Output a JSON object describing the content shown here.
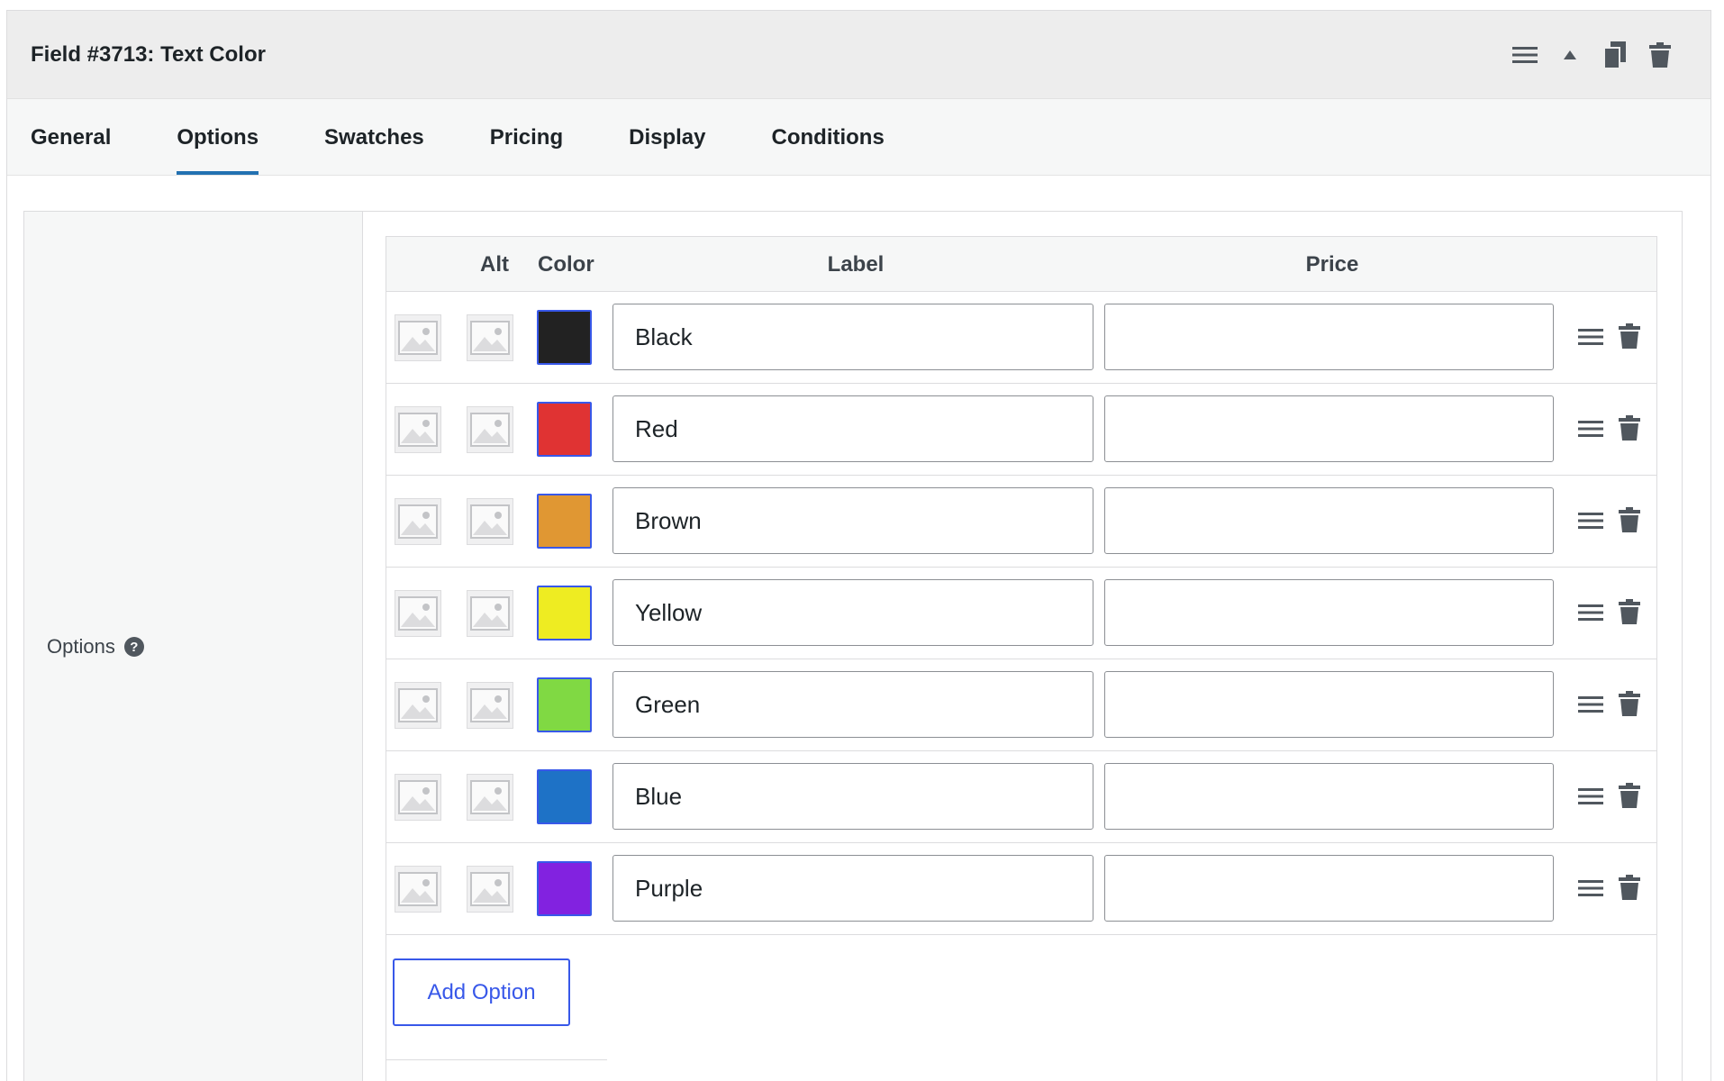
{
  "header": {
    "title": "Field #3713: Text Color",
    "icons": [
      "drag-handle-icon",
      "collapse-arrow-icon",
      "duplicate-icon",
      "trash-icon"
    ]
  },
  "tabs": [
    {
      "label": "General",
      "active": false
    },
    {
      "label": "Options",
      "active": true
    },
    {
      "label": "Swatches",
      "active": false
    },
    {
      "label": "Pricing",
      "active": false
    },
    {
      "label": "Display",
      "active": false
    },
    {
      "label": "Conditions",
      "active": false
    }
  ],
  "section": {
    "label": "Options",
    "help_icon": "?"
  },
  "table": {
    "columns": {
      "alt": "Alt",
      "color": "Color",
      "label": "Label",
      "price": "Price"
    },
    "rows": [
      {
        "label": "Black",
        "color": "#222222",
        "price": ""
      },
      {
        "label": "Red",
        "color": "#e03333",
        "price": ""
      },
      {
        "label": "Brown",
        "color": "#e09733",
        "price": ""
      },
      {
        "label": "Yellow",
        "color": "#eeec22",
        "price": ""
      },
      {
        "label": "Green",
        "color": "#80d943",
        "price": ""
      },
      {
        "label": "Blue",
        "color": "#1e72c6",
        "price": ""
      },
      {
        "label": "Purple",
        "color": "#8222e0",
        "price": ""
      }
    ]
  },
  "add_option_label": "Add Option",
  "colors": {
    "accent": "#3858e9",
    "tab_underline": "#2271b1",
    "header_bg": "#ededed"
  }
}
